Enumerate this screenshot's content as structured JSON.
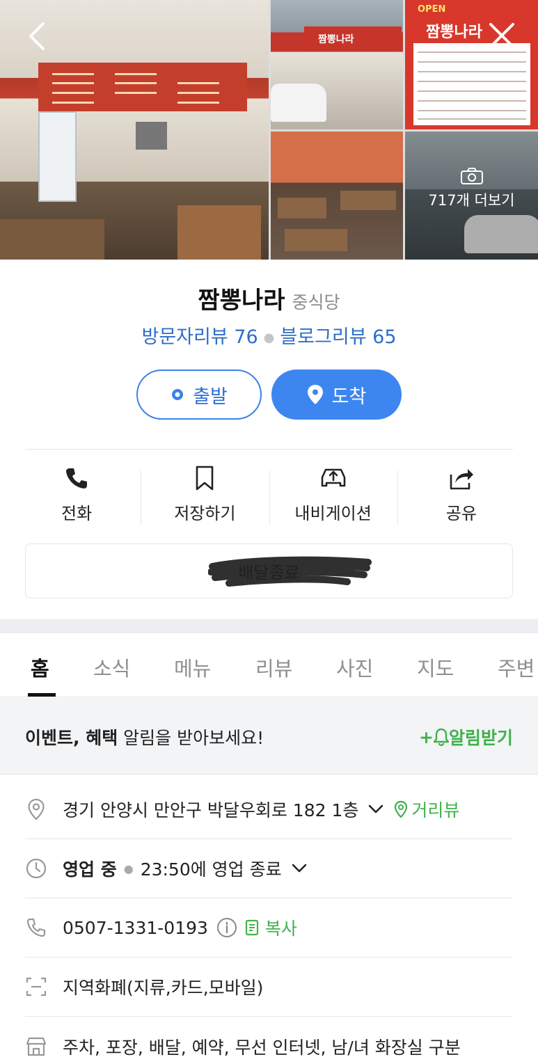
{
  "photos": {
    "more_label": "717개 더보기",
    "sign_text": "짬뽕나라",
    "board_brand": "짬뽕나라",
    "board_open": "OPEN"
  },
  "place": {
    "name": "짬뽕나라",
    "category": "중식당",
    "visitor_reviews": "방문자리뷰 76",
    "blog_reviews": "블로그리뷰 65"
  },
  "route": {
    "depart_label": "출발",
    "arrive_label": "도착"
  },
  "actions": [
    {
      "label": "전화",
      "icon": "phone-icon"
    },
    {
      "label": "저장하기",
      "icon": "bookmark-icon"
    },
    {
      "label": "내비게이션",
      "icon": "navigation-car-icon"
    },
    {
      "label": "공유",
      "icon": "share-icon"
    }
  ],
  "delivery": {
    "label": "배달종료"
  },
  "tabs": [
    "홈",
    "소식",
    "메뉴",
    "리뷰",
    "사진",
    "지도",
    "주변"
  ],
  "active_tab": "홈",
  "banner": {
    "bold": "이벤트, 혜택",
    "rest": " 알림을 받아보세요!",
    "action": "알림받기"
  },
  "info": {
    "address": "경기 안양시 만안구 박달우회로 182 1층",
    "street_view": "거리뷰",
    "status": "영업 중",
    "hours": "23:50에 영업 종료",
    "phone": "0507-1331-0193",
    "copy": "복사",
    "payment": "지역화폐(지류,카드,모바일)",
    "amenities": "주차, 포장, 배달, 예약, 무선 인터넷, 남/녀 화장실 구분"
  },
  "colors": {
    "accent_blue": "#3d86f0",
    "review_blue": "#2d6ec7",
    "green": "#3fb24b"
  }
}
